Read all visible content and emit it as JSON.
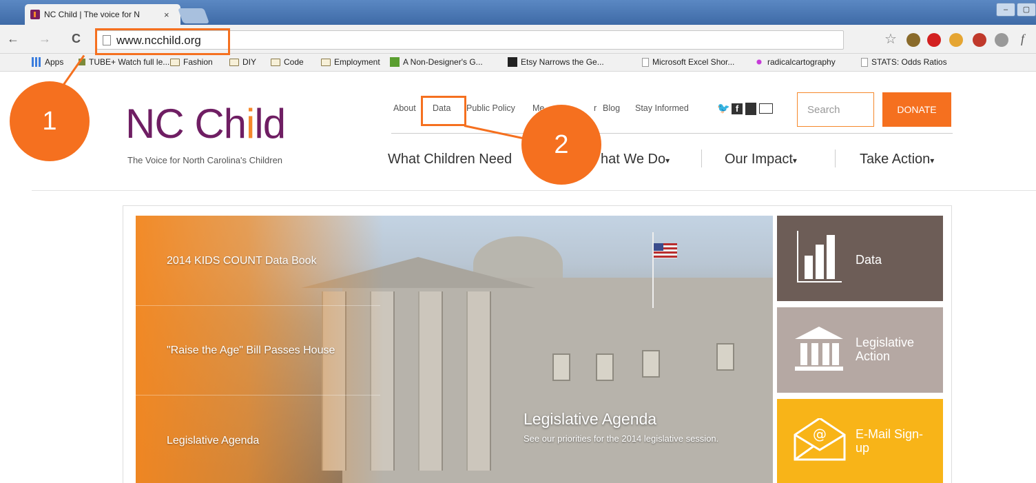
{
  "browser": {
    "tab_title": "NC Child | The voice for N",
    "tab_close": "×",
    "url": "www.ncchild.org",
    "window_buttons": [
      "–",
      "▢"
    ],
    "bookmarks": [
      "Apps",
      "TUBE+ Watch full le...",
      "Fashion",
      "DIY",
      "Code",
      "Employment",
      "A Non-Designer's G...",
      "Etsy Narrows the Ge...",
      "Microsoft Excel Shor...",
      "radicalcartography",
      "STATS: Odds Ratios"
    ]
  },
  "site": {
    "logo": {
      "text_a": "NC Ch",
      "text_b": "i",
      "text_c": "ld",
      "tagline": "The Voice for North Carolina's Children"
    },
    "top_nav": [
      "About",
      "Data",
      "Public Policy",
      "Me",
      "r",
      "Blog",
      "Stay Informed"
    ],
    "social_icons": [
      "twitter-icon",
      "facebook-icon",
      "youtube-icon",
      "mail-icon"
    ],
    "search_placeholder": "Search",
    "donate": "DONATE",
    "main_nav": [
      "What Children Need",
      "hat We Do",
      "Our Impact",
      "Take Action"
    ],
    "dropdown_caret": "▾"
  },
  "carousel": {
    "items": [
      "2014 KIDS COUNT Data Book",
      "\"Raise the Age\" Bill Passes House",
      "Legislative Agenda"
    ],
    "caption_title": "Legislative Agenda",
    "caption_sub": "See our priorities for the 2014 legislative session."
  },
  "tiles": [
    {
      "label": "Data",
      "color": "#6d5d57"
    },
    {
      "label": "Legislative Action",
      "color": "#b5a8a3"
    },
    {
      "label": "E-Mail Sign-up",
      "color": "#f8b418"
    }
  ],
  "annotations": {
    "one": "1",
    "two": "2",
    "color": "#f5701f"
  }
}
